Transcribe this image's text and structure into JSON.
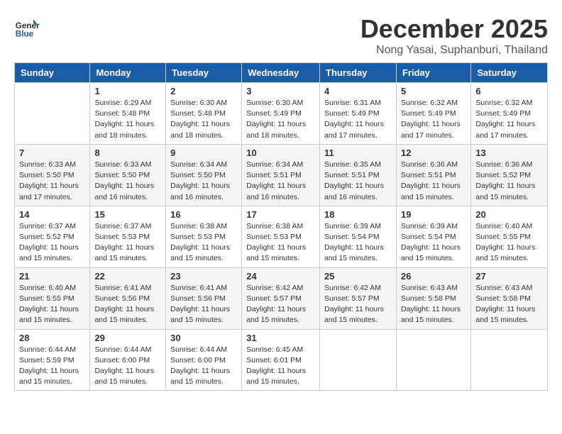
{
  "header": {
    "logo_general": "General",
    "logo_blue": "Blue",
    "month_title": "December 2025",
    "location": "Nong Yasai, Suphanburi, Thailand"
  },
  "weekdays": [
    "Sunday",
    "Monday",
    "Tuesday",
    "Wednesday",
    "Thursday",
    "Friday",
    "Saturday"
  ],
  "weeks": [
    [
      {
        "day": "",
        "info": ""
      },
      {
        "day": "1",
        "info": "Sunrise: 6:29 AM\nSunset: 5:48 PM\nDaylight: 11 hours\nand 18 minutes."
      },
      {
        "day": "2",
        "info": "Sunrise: 6:30 AM\nSunset: 5:48 PM\nDaylight: 11 hours\nand 18 minutes."
      },
      {
        "day": "3",
        "info": "Sunrise: 6:30 AM\nSunset: 5:49 PM\nDaylight: 11 hours\nand 18 minutes."
      },
      {
        "day": "4",
        "info": "Sunrise: 6:31 AM\nSunset: 5:49 PM\nDaylight: 11 hours\nand 17 minutes."
      },
      {
        "day": "5",
        "info": "Sunrise: 6:32 AM\nSunset: 5:49 PM\nDaylight: 11 hours\nand 17 minutes."
      },
      {
        "day": "6",
        "info": "Sunrise: 6:32 AM\nSunset: 5:49 PM\nDaylight: 11 hours\nand 17 minutes."
      }
    ],
    [
      {
        "day": "7",
        "info": "Sunrise: 6:33 AM\nSunset: 5:50 PM\nDaylight: 11 hours\nand 17 minutes."
      },
      {
        "day": "8",
        "info": "Sunrise: 6:33 AM\nSunset: 5:50 PM\nDaylight: 11 hours\nand 16 minutes."
      },
      {
        "day": "9",
        "info": "Sunrise: 6:34 AM\nSunset: 5:50 PM\nDaylight: 11 hours\nand 16 minutes."
      },
      {
        "day": "10",
        "info": "Sunrise: 6:34 AM\nSunset: 5:51 PM\nDaylight: 11 hours\nand 16 minutes."
      },
      {
        "day": "11",
        "info": "Sunrise: 6:35 AM\nSunset: 5:51 PM\nDaylight: 11 hours\nand 16 minutes."
      },
      {
        "day": "12",
        "info": "Sunrise: 6:36 AM\nSunset: 5:51 PM\nDaylight: 11 hours\nand 15 minutes."
      },
      {
        "day": "13",
        "info": "Sunrise: 6:36 AM\nSunset: 5:52 PM\nDaylight: 11 hours\nand 15 minutes."
      }
    ],
    [
      {
        "day": "14",
        "info": "Sunrise: 6:37 AM\nSunset: 5:52 PM\nDaylight: 11 hours\nand 15 minutes."
      },
      {
        "day": "15",
        "info": "Sunrise: 6:37 AM\nSunset: 5:53 PM\nDaylight: 11 hours\nand 15 minutes."
      },
      {
        "day": "16",
        "info": "Sunrise: 6:38 AM\nSunset: 5:53 PM\nDaylight: 11 hours\nand 15 minutes."
      },
      {
        "day": "17",
        "info": "Sunrise: 6:38 AM\nSunset: 5:53 PM\nDaylight: 11 hours\nand 15 minutes."
      },
      {
        "day": "18",
        "info": "Sunrise: 6:39 AM\nSunset: 5:54 PM\nDaylight: 11 hours\nand 15 minutes."
      },
      {
        "day": "19",
        "info": "Sunrise: 6:39 AM\nSunset: 5:54 PM\nDaylight: 11 hours\nand 15 minutes."
      },
      {
        "day": "20",
        "info": "Sunrise: 6:40 AM\nSunset: 5:55 PM\nDaylight: 11 hours\nand 15 minutes."
      }
    ],
    [
      {
        "day": "21",
        "info": "Sunrise: 6:40 AM\nSunset: 5:55 PM\nDaylight: 11 hours\nand 15 minutes."
      },
      {
        "day": "22",
        "info": "Sunrise: 6:41 AM\nSunset: 5:56 PM\nDaylight: 11 hours\nand 15 minutes."
      },
      {
        "day": "23",
        "info": "Sunrise: 6:41 AM\nSunset: 5:56 PM\nDaylight: 11 hours\nand 15 minutes."
      },
      {
        "day": "24",
        "info": "Sunrise: 6:42 AM\nSunset: 5:57 PM\nDaylight: 11 hours\nand 15 minutes."
      },
      {
        "day": "25",
        "info": "Sunrise: 6:42 AM\nSunset: 5:57 PM\nDaylight: 11 hours\nand 15 minutes."
      },
      {
        "day": "26",
        "info": "Sunrise: 6:43 AM\nSunset: 5:58 PM\nDaylight: 11 hours\nand 15 minutes."
      },
      {
        "day": "27",
        "info": "Sunrise: 6:43 AM\nSunset: 5:58 PM\nDaylight: 11 hours\nand 15 minutes."
      }
    ],
    [
      {
        "day": "28",
        "info": "Sunrise: 6:44 AM\nSunset: 5:59 PM\nDaylight: 11 hours\nand 15 minutes."
      },
      {
        "day": "29",
        "info": "Sunrise: 6:44 AM\nSunset: 6:00 PM\nDaylight: 11 hours\nand 15 minutes."
      },
      {
        "day": "30",
        "info": "Sunrise: 6:44 AM\nSunset: 6:00 PM\nDaylight: 11 hours\nand 15 minutes."
      },
      {
        "day": "31",
        "info": "Sunrise: 6:45 AM\nSunset: 6:01 PM\nDaylight: 11 hours\nand 15 minutes."
      },
      {
        "day": "",
        "info": ""
      },
      {
        "day": "",
        "info": ""
      },
      {
        "day": "",
        "info": ""
      }
    ]
  ]
}
